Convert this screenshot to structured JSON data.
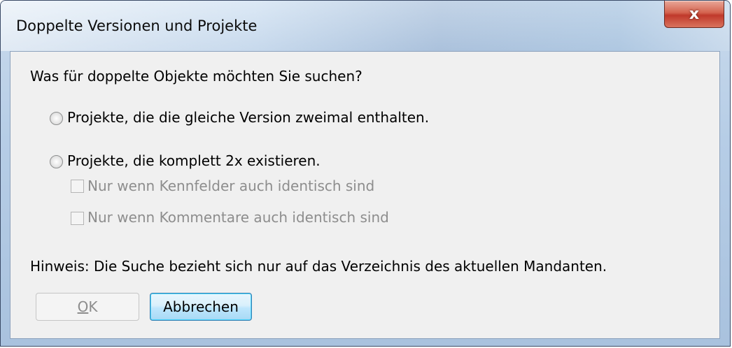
{
  "window": {
    "title": "Doppelte Versionen und Projekte",
    "close_label": "x"
  },
  "dialog": {
    "question": "Was für doppelte Objekte möchten Sie suchen?",
    "options": [
      {
        "label": "Projekte, die die gleiche Version zweimal enthalten.",
        "selected": false
      },
      {
        "label": "Projekte, die komplett 2x existieren.",
        "selected": false
      }
    ],
    "suboptions": [
      {
        "label": "Nur wenn Kennfelder auch identisch sind",
        "checked": false,
        "enabled": false
      },
      {
        "label": "Nur wenn Kommentare auch identisch sind",
        "checked": false,
        "enabled": false
      }
    ],
    "hint": "Hinweis: Die Suche bezieht sich nur auf das Verzeichnis des aktuellen Mandanten."
  },
  "buttons": {
    "ok_mnemonic": "O",
    "ok_rest": "K",
    "cancel_label": "Abbrechen"
  }
}
